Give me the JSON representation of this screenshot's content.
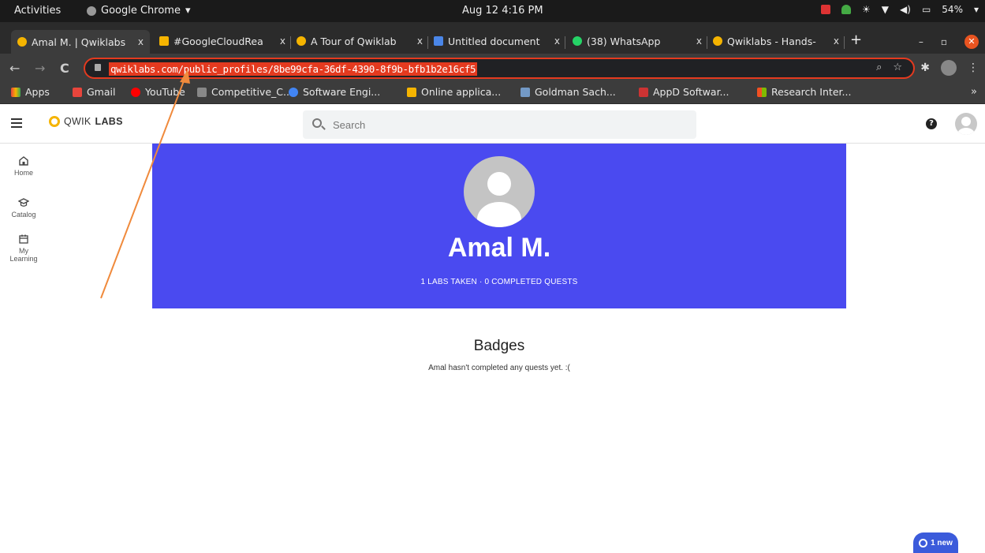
{
  "os": {
    "activities": "Activities",
    "app_name": "Google Chrome",
    "clock": "Aug 12  4:16 PM",
    "battery": "54%"
  },
  "tabs": [
    {
      "label": "Amal M. | Qwiklabs",
      "icon_color": "#f5b400"
    },
    {
      "label": "#GoogleCloudRea",
      "icon_color": "#f5b400"
    },
    {
      "label": "A Tour of Qwiklab",
      "icon_color": "#f5b400"
    },
    {
      "label": "Untitled document",
      "icon_color": "#4a86e8"
    },
    {
      "label": "(38) WhatsApp",
      "icon_color": "#25d366"
    },
    {
      "label": "Qwiklabs - Hands-",
      "icon_color": "#f5b400"
    }
  ],
  "tab_close": "x",
  "address_bar": {
    "url": "qwiklabs.com/public_profiles/8be99cfa-36df-4390-8f9b-bfb1b2e16cf5"
  },
  "bookmarks": [
    {
      "label": "Apps",
      "icon_color": "#e8453c"
    },
    {
      "label": "Gmail",
      "icon_color": "#e8453c"
    },
    {
      "label": "YouTube",
      "icon_color": "#ff0000"
    },
    {
      "label": "Competitive_C...",
      "icon_color": "#888888"
    },
    {
      "label": "Software Engi...",
      "icon_color": "#4285f4"
    },
    {
      "label": "Online applica...",
      "icon_color": "#f5b400"
    },
    {
      "label": "Goldman Sach...",
      "icon_color": "#7399c6"
    },
    {
      "label": "AppD Softwar...",
      "icon_color": "#cc3333"
    },
    {
      "label": "Research Inter...",
      "icon_color": "#f25022"
    }
  ],
  "bookmarks_more": "»",
  "qwiklabs": {
    "logo_prefix": "QWIK",
    "logo_suffix": "LABS",
    "search_placeholder": "Search",
    "help": "?"
  },
  "sidebar": [
    {
      "label": "Home"
    },
    {
      "label": "Catalog"
    },
    {
      "label": "My Learning"
    }
  ],
  "profile": {
    "name": "Amal M.",
    "stats": "1 LABS TAKEN · 0 COMPLETED QUESTS"
  },
  "badges": {
    "title": "Badges",
    "message": "Amal hasn't completed any quests yet. :("
  },
  "chat": {
    "label": "1 new"
  },
  "colors": {
    "banner": "#4a4af0",
    "highlight": "#e43a1f",
    "annotation_arrow": "#f08a3c"
  }
}
